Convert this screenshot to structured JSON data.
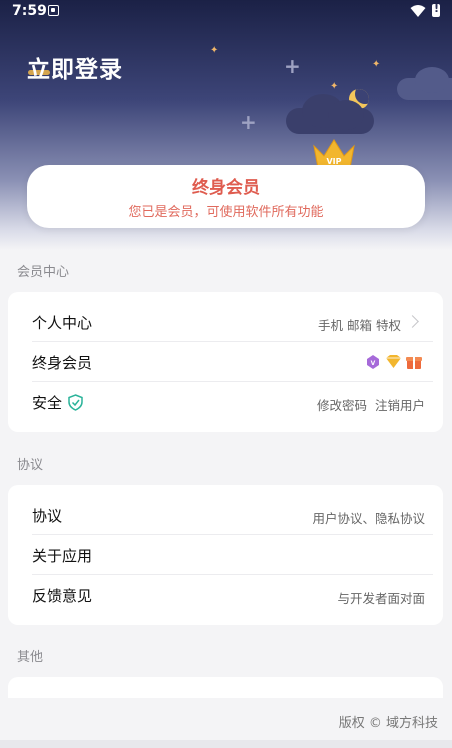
{
  "status": {
    "time": "7:59"
  },
  "header": {
    "login_label": "立即登录"
  },
  "member_card": {
    "title": "终身会员",
    "description": "您已是会员，可使用软件所有功能",
    "crown_text": "VIP"
  },
  "sections": {
    "member_center": {
      "label": "会员中心",
      "rows": [
        {
          "label": "个人中心",
          "value": "手机 邮箱 特权"
        },
        {
          "label": "终身会员",
          "badges": [
            "vip-badge-icon",
            "diamond-icon",
            "gift-icon"
          ]
        },
        {
          "label": "安全",
          "value": "修改密码  注销用户"
        }
      ]
    },
    "agreement": {
      "label": "协议",
      "rows": [
        {
          "label": "协议",
          "value": "用户协议、隐私协议"
        },
        {
          "label": "关于应用",
          "value": ""
        },
        {
          "label": "反馈意见",
          "value": "与开发者面对面"
        }
      ]
    },
    "other": {
      "label": "其他"
    }
  },
  "footer": {
    "copyright": "版权 © 域方科技"
  },
  "colors": {
    "accent": "#df5c4f",
    "header_dark": "#1b2146",
    "background": "#f4f4f6"
  }
}
